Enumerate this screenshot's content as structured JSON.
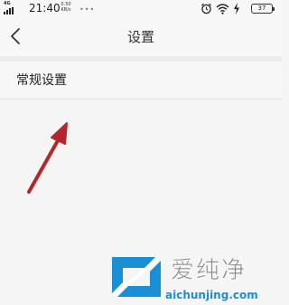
{
  "status_bar": {
    "network": "4G",
    "time": "21:40",
    "speed_value": "0.50",
    "speed_unit": "KB/s",
    "more_indicator": "•••",
    "battery": "37",
    "icons": [
      "signal-icon",
      "alarm-icon",
      "wifi-icon",
      "charging-icon",
      "battery-icon"
    ]
  },
  "header": {
    "title": "设置",
    "back_icon": "chevron-left-icon"
  },
  "settings": {
    "items": [
      {
        "label": "常规设置"
      }
    ]
  },
  "annotation": {
    "icon": "red-arrow-pointer",
    "color": "#b3262b"
  },
  "watermark": {
    "title": "爱纯净",
    "url": "aichunjing.com",
    "logo_color": "#1a8fd6"
  }
}
